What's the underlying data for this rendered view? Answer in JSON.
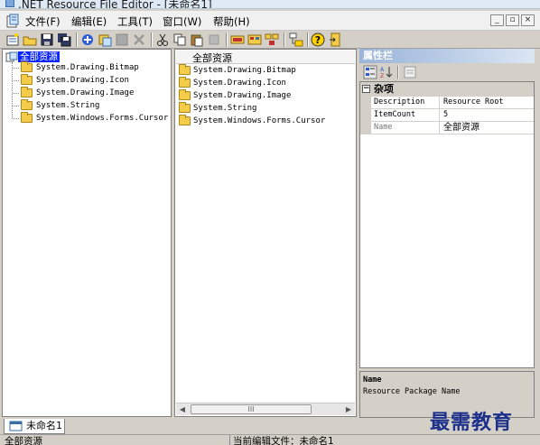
{
  "window": {
    "title": ".NET Resource File Editor - [未命名1]"
  },
  "menu": {
    "items": [
      {
        "label": "文件(F)"
      },
      {
        "label": "编辑(E)"
      },
      {
        "label": "工具(T)"
      },
      {
        "label": "窗口(W)"
      },
      {
        "label": "帮助(H)"
      }
    ],
    "mdi_buttons": [
      "_",
      "▫",
      "×"
    ]
  },
  "toolbar": {
    "icons": [
      "new-project-icon",
      "open-folder-icon",
      "save-icon",
      "save-all-icon",
      "add-resource-icon",
      "add-file-icon",
      "disabled-icon",
      "delete-icon",
      "cut-icon",
      "copy-icon",
      "paste-icon",
      "disabled-icon-2",
      "view-a-icon",
      "view-b-icon",
      "view-c-icon",
      "tree-icon",
      "help-icon",
      "exit-icon"
    ]
  },
  "tree": {
    "root": "全部资源",
    "items": [
      "System.Drawing.Bitmap",
      "System.Drawing.Icon",
      "System.Drawing.Image",
      "System.String",
      "System.Windows.Forms.Cursor"
    ]
  },
  "list": {
    "header": "全部资源",
    "items": [
      "System.Drawing.Bitmap",
      "System.Drawing.Icon",
      "System.Drawing.Image",
      "System.String",
      "System.Windows.Forms.Cursor"
    ],
    "scroll_thumb": "III"
  },
  "properties": {
    "header": "属性栏",
    "category": "杂项",
    "rows": [
      {
        "key": "Description",
        "value": "Resource Root"
      },
      {
        "key": "ItemCount",
        "value": "5"
      },
      {
        "key": "Name",
        "value": "全部资源"
      }
    ],
    "desc_title": "Name",
    "desc_text": "Resource Package Name"
  },
  "doc_tab": {
    "label": "未命名1"
  },
  "status": {
    "left": "全部资源",
    "right": "当前编辑文件：未命名1"
  },
  "watermark": "最需教育"
}
